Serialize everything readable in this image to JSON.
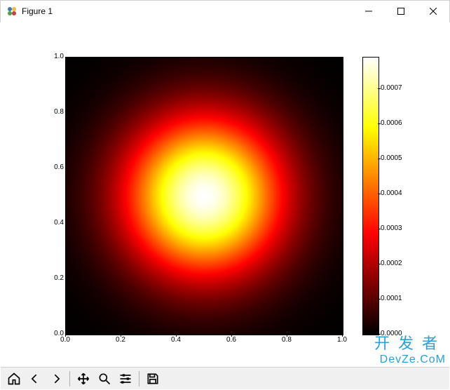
{
  "window": {
    "title": "Figure 1",
    "minimize_tooltip": "Minimize",
    "maximize_tooltip": "Maximize",
    "close_tooltip": "Close"
  },
  "toolbar": {
    "home": "Home",
    "back": "Back",
    "forward": "Forward",
    "pan": "Pan",
    "zoom": "Zoom",
    "configure": "Configure subplots",
    "save": "Save the figure"
  },
  "watermark": {
    "line1": "开发者",
    "line2": "DevZe.CoM"
  },
  "chart_data": {
    "type": "heatmap",
    "description": "2-D Gaussian density on a unit square rendered with matplotlib 'hot' colormap; peak at centre.",
    "x_range": [
      0.0,
      1.0
    ],
    "y_range": [
      0.0,
      1.0
    ],
    "x_ticks": [
      0.0,
      0.2,
      0.4,
      0.6,
      0.8,
      1.0
    ],
    "y_ticks": [
      0.0,
      0.2,
      0.4,
      0.6,
      0.8,
      1.0
    ],
    "x_tick_labels": [
      "0.0",
      "0.2",
      "0.4",
      "0.6",
      "0.8",
      "1.0"
    ],
    "y_tick_labels": [
      "0.0",
      "0.2",
      "0.4",
      "0.6",
      "0.8",
      "1.0"
    ],
    "colorbar": {
      "range": [
        0.0,
        0.00079
      ],
      "ticks": [
        0.0,
        0.0001,
        0.0002,
        0.0003,
        0.0004,
        0.0005,
        0.0006,
        0.0007
      ],
      "tick_labels": [
        "0.0000",
        "0.0001",
        "0.0002",
        "0.0003",
        "0.0004",
        "0.0005",
        "0.0006",
        "0.0007"
      ]
    },
    "gaussian": {
      "center_x": 0.5,
      "center_y": 0.5,
      "sigma": 0.2,
      "peak_value": 0.00079
    },
    "colormap": "hot"
  }
}
